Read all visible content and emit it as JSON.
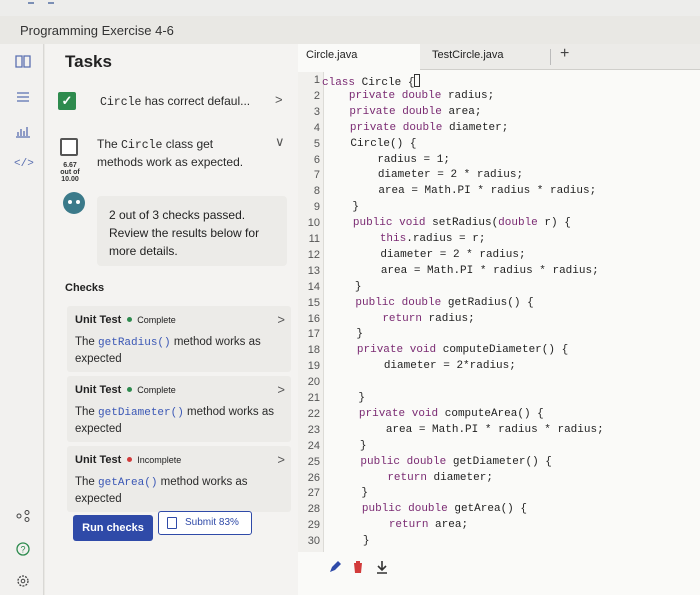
{
  "app": {
    "title": "Programming Exercise 4-6"
  },
  "tasks": {
    "heading": "Tasks",
    "task1": {
      "code": "Circle",
      "text": " has correct defaul..."
    },
    "task2": {
      "prefix": "The ",
      "code": "Circle",
      "suffix": " class get",
      "line2": "methods work as expected.",
      "score_top": "6.67",
      "score_mid": "out of",
      "score_bot": "10.00"
    },
    "result": "2 out of 3 checks passed. Review the results below for more details."
  },
  "checks": {
    "label": "Checks",
    "items": [
      {
        "title": "Unit Test",
        "status": "Complete",
        "status_color": "#2e8b4e",
        "pre": "The ",
        "code": "getRadius()",
        "post": " method works as expected"
      },
      {
        "title": "Unit Test",
        "status": "Complete",
        "status_color": "#2e8b4e",
        "pre": "The ",
        "code": "getDiameter()",
        "post": " method works as expected"
      },
      {
        "title": "Unit Test",
        "status": "Incomplete",
        "status_color": "#d23b3b",
        "pre": "The ",
        "code": "getArea()",
        "post": " method works as expected"
      }
    ]
  },
  "buttons": {
    "run": "Run checks",
    "submit": "Submit 83%"
  },
  "editor": {
    "tabs": [
      "Circle.java",
      "TestCircle.java"
    ],
    "plus": "+",
    "line_numbers": [
      "1",
      "2",
      "3",
      "4",
      "5",
      "6",
      "7",
      "8",
      "9",
      "10",
      "11",
      "12",
      "13",
      "14",
      "15",
      "16",
      "17",
      "18",
      "19",
      "20",
      "21",
      "22",
      "23",
      "24",
      "25",
      "26",
      "27",
      "28",
      "29",
      "30"
    ],
    "lines": [
      "class Circle ",
      "    private double radius;",
      "    private double area;",
      "    private double diameter;",
      "    Circle() {",
      "        radius = 1;",
      "        diameter = 2 * radius;",
      "        area = Math.PI * radius * radius;",
      "    }",
      "    public void setRadius(double r) {",
      "        this.radius = r;",
      "        diameter = 2 * radius;",
      "        area = Math.PI * radius * radius;",
      "    }",
      "    public double getRadius() {",
      "        return radius;",
      "    }",
      "    private void computeDiameter() {",
      "        diameter = 2*radius;",
      "",
      "    }",
      "    private void computeArea() {",
      "        area = Math.PI * radius * radius;",
      "    }",
      "    public double getDiameter() {",
      "        return diameter;",
      "    }",
      "    public double getArea() {",
      "        return area;",
      "    }"
    ],
    "line1_brace": "{"
  },
  "icons": {
    "rail": [
      "book-icon",
      "list-icon",
      "chart-icon",
      "code-icon",
      "share-icon",
      "help-icon",
      "settings-icon"
    ],
    "tools": [
      "pencil-icon",
      "trash-icon",
      "download-icon"
    ]
  },
  "colors": {
    "accent": "#2f4aa8",
    "complete": "#2e8b4e",
    "incomplete": "#d23b3b",
    "keyword": "#7a2a72"
  }
}
